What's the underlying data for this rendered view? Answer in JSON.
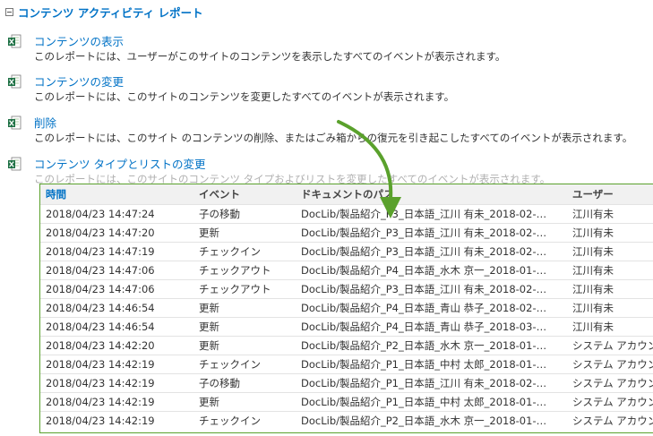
{
  "section": {
    "title": "コンテンツ アクティビティ レポート"
  },
  "reports": [
    {
      "title": "コンテンツの表示",
      "description": "このレポートには、ユーザーがこのサイトのコンテンツを表示したすべてのイベントが表示されます。"
    },
    {
      "title": "コンテンツの変更",
      "description": "このレポートには、このサイトのコンテンツを変更したすべてのイベントが表示されます。"
    },
    {
      "title": "削除",
      "description": "このレポートには、このサイト のコンテンツの削除、またはごみ箱からの復元を引き起こしたすべてのイベントが表示されます。"
    },
    {
      "title": "コンテンツ タイプとリストの変更",
      "description": "このレポートには、このサイトのコンテンツ タイプおよびリストを変更したすべてのイベントが表示されます。"
    }
  ],
  "table": {
    "headers": {
      "time": "時間",
      "event": "イベント",
      "path": "ドキュメントのパス",
      "user": "ユーザー"
    },
    "rows": [
      {
        "time": "2018/04/23 14:47:24",
        "event": "子の移動",
        "path": "DocLib/製品紹介_P3_日本語_江川 有未_2018-02-…",
        "user": "江川有未"
      },
      {
        "time": "2018/04/23 14:47:20",
        "event": "更新",
        "path": "DocLib/製品紹介_P3_日本語_江川 有未_2018-02-…",
        "user": "江川有未"
      },
      {
        "time": "2018/04/23 14:47:19",
        "event": "チェックイン",
        "path": "DocLib/製品紹介_P3_日本語_江川 有未_2018-02-…",
        "user": "江川有未"
      },
      {
        "time": "2018/04/23 14:47:06",
        "event": "チェックアウト",
        "path": "DocLib/製品紹介_P4_日本語_水木 京一_2018-01-…",
        "user": "江川有未"
      },
      {
        "time": "2018/04/23 14:47:06",
        "event": "チェックアウト",
        "path": "DocLib/製品紹介_P3_日本語_江川 有未_2018-02-…",
        "user": "江川有未"
      },
      {
        "time": "2018/04/23 14:46:54",
        "event": "更新",
        "path": "DocLib/製品紹介_P4_日本語_青山 恭子_2018-02-…",
        "user": "江川有未"
      },
      {
        "time": "2018/04/23 14:46:54",
        "event": "更新",
        "path": "DocLib/製品紹介_P4_日本語_青山 恭子_2018-03-…",
        "user": "江川有未"
      },
      {
        "time": "2018/04/23 14:42:20",
        "event": "更新",
        "path": "DocLib/製品紹介_P2_日本語_水木 京一_2018-01-…",
        "user": "システム アカウント"
      },
      {
        "time": "2018/04/23 14:42:19",
        "event": "チェックイン",
        "path": "DocLib/製品紹介_P1_日本語_中村 太郎_2018-01-…",
        "user": "システム アカウント"
      },
      {
        "time": "2018/04/23 14:42:19",
        "event": "子の移動",
        "path": "DocLib/製品紹介_P1_日本語_江川 有未_2018-02-…",
        "user": "システム アカウント"
      },
      {
        "time": "2018/04/23 14:42:19",
        "event": "更新",
        "path": "DocLib/製品紹介_P1_日本語_中村 太郎_2018-01-…",
        "user": "システム アカウント"
      },
      {
        "time": "2018/04/23 14:42:19",
        "event": "チェックイン",
        "path": "DocLib/製品紹介_P2_日本語_水木 京一_2018-01-…",
        "user": "システム アカウント"
      }
    ]
  },
  "colors": {
    "link": "#0072c6",
    "highlight_border": "#5aa12c",
    "excel_green": "#1e7145"
  },
  "icons": {
    "report_icon": "excel-file-icon",
    "collapse_icon": "collapse-minus-icon",
    "annotation": "curved-arrow-icon"
  }
}
